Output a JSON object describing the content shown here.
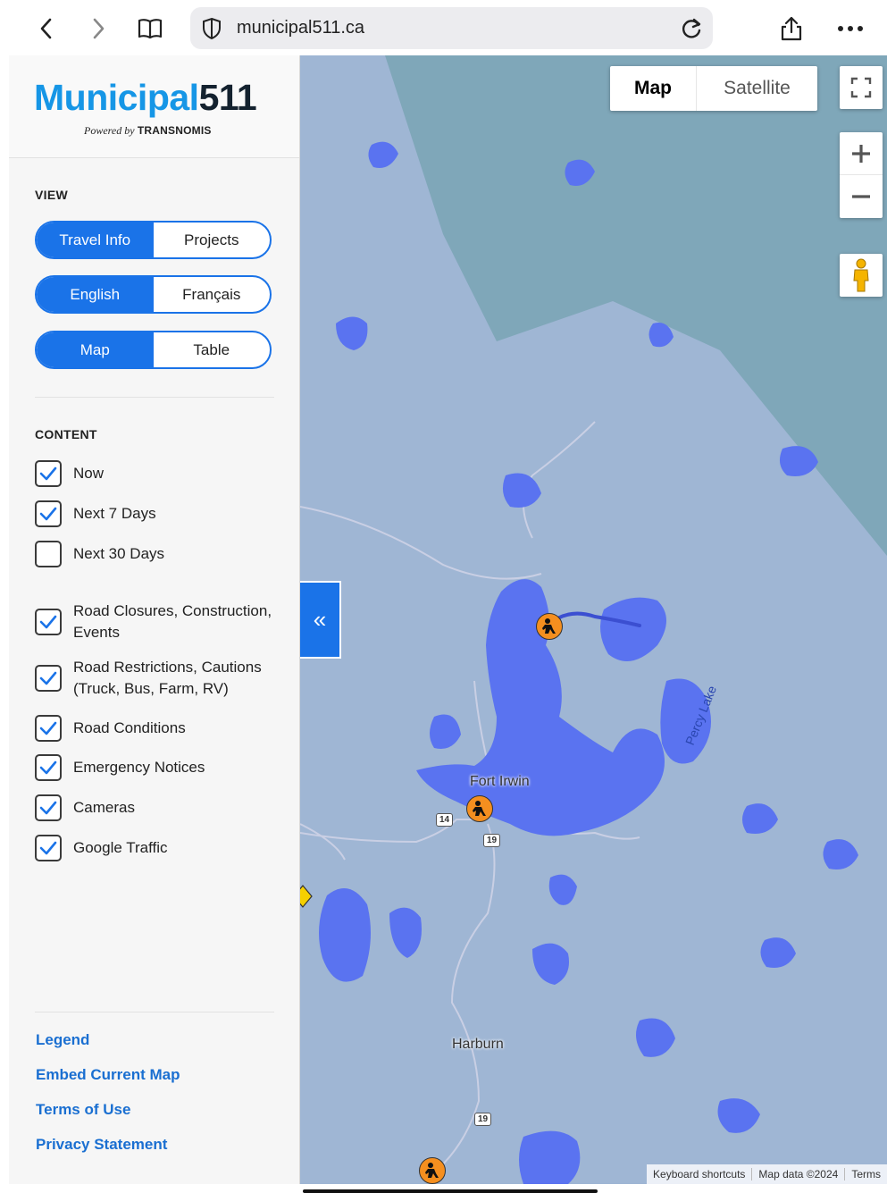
{
  "browser": {
    "url": "municipal511.ca",
    "back_icon": "chevron-left-icon",
    "forward_icon": "chevron-right-icon",
    "bookmarks_icon": "book-icon",
    "shield_icon": "shield-icon",
    "reload_icon": "reload-icon",
    "share_icon": "share-icon",
    "more_icon": "ellipsis-icon"
  },
  "logo": {
    "name_part1": "Municipal",
    "name_part2": "511",
    "powered_by": "Powered by",
    "brand": "TRANSNOMIS",
    "colors": {
      "blue": "#1696e6",
      "dark": "#14222f"
    }
  },
  "view": {
    "heading": "VIEW",
    "mode_toggle": {
      "options": [
        "Travel Info",
        "Projects"
      ],
      "selected": "Travel Info"
    },
    "language_toggle": {
      "options": [
        "English",
        "Français"
      ],
      "selected": "English"
    },
    "display_toggle": {
      "options": [
        "Map",
        "Table"
      ],
      "selected": "Map"
    }
  },
  "content": {
    "heading": "CONTENT",
    "time_filters": [
      {
        "label": "Now",
        "checked": true
      },
      {
        "label": "Next 7 Days",
        "checked": true
      },
      {
        "label": "Next 30 Days",
        "checked": false
      }
    ],
    "layers": [
      {
        "label": "Road Closures, Construction, Events",
        "checked": true
      },
      {
        "label": "Road Restrictions, Cautions (Truck, Bus, Farm, RV)",
        "checked": true
      },
      {
        "label": "Road Conditions",
        "checked": true
      },
      {
        "label": "Emergency Notices",
        "checked": true
      },
      {
        "label": "Cameras",
        "checked": true
      },
      {
        "label": "Google Traffic",
        "checked": true
      }
    ]
  },
  "footer_links": [
    "Legend",
    "Embed Current Map",
    "Terms of Use",
    "Privacy Statement"
  ],
  "map": {
    "type_options": [
      "Map",
      "Satellite"
    ],
    "selected_type": "Map",
    "collapse_symbol": "«",
    "places": [
      "Fort Irwin",
      "Harburn"
    ],
    "lakes": [
      "Percy Lake"
    ],
    "route_shields": [
      "14",
      "19",
      "19"
    ],
    "attribution": [
      "Keyboard shortcuts",
      "Map data ©2024",
      "Terms"
    ],
    "accent_color": "#1a73e8",
    "marker_color": "#f58f1f"
  }
}
